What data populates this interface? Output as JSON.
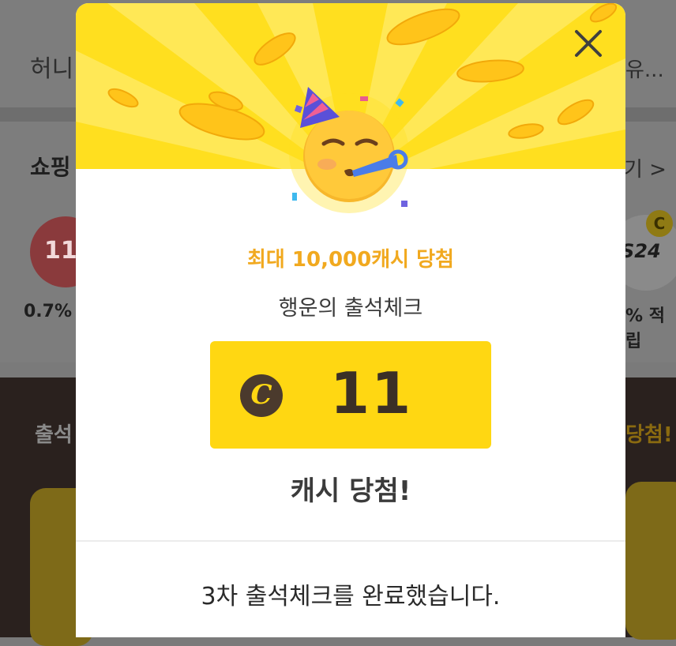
{
  "background": {
    "top_title": "허니",
    "top_right": "유...",
    "shop_title": "쇼핑",
    "shop_more": "기 >",
    "logo_left_text": "11",
    "logo_right_text": "S24",
    "coin_label": "C",
    "rate_left": "0.7%",
    "rate_right": "% 적립",
    "dark_left": "출석",
    "dark_right": "당첨!"
  },
  "modal": {
    "close_icon": "close-icon",
    "prize_max": "최대 10,000캐시 당첨",
    "event_name": "행운의 출석체크",
    "cash_icon_letter": "C",
    "cash_amount": "11",
    "won_text": "캐시 당첨!",
    "done_message": "3차 출석체크를 완료했습니다."
  },
  "colors": {
    "hero_yellow": "#ffdf1f",
    "accent_orange": "#f1a91f",
    "cash_box_yellow": "#ffd712",
    "cash_icon_brown": "#4b3a2d"
  }
}
